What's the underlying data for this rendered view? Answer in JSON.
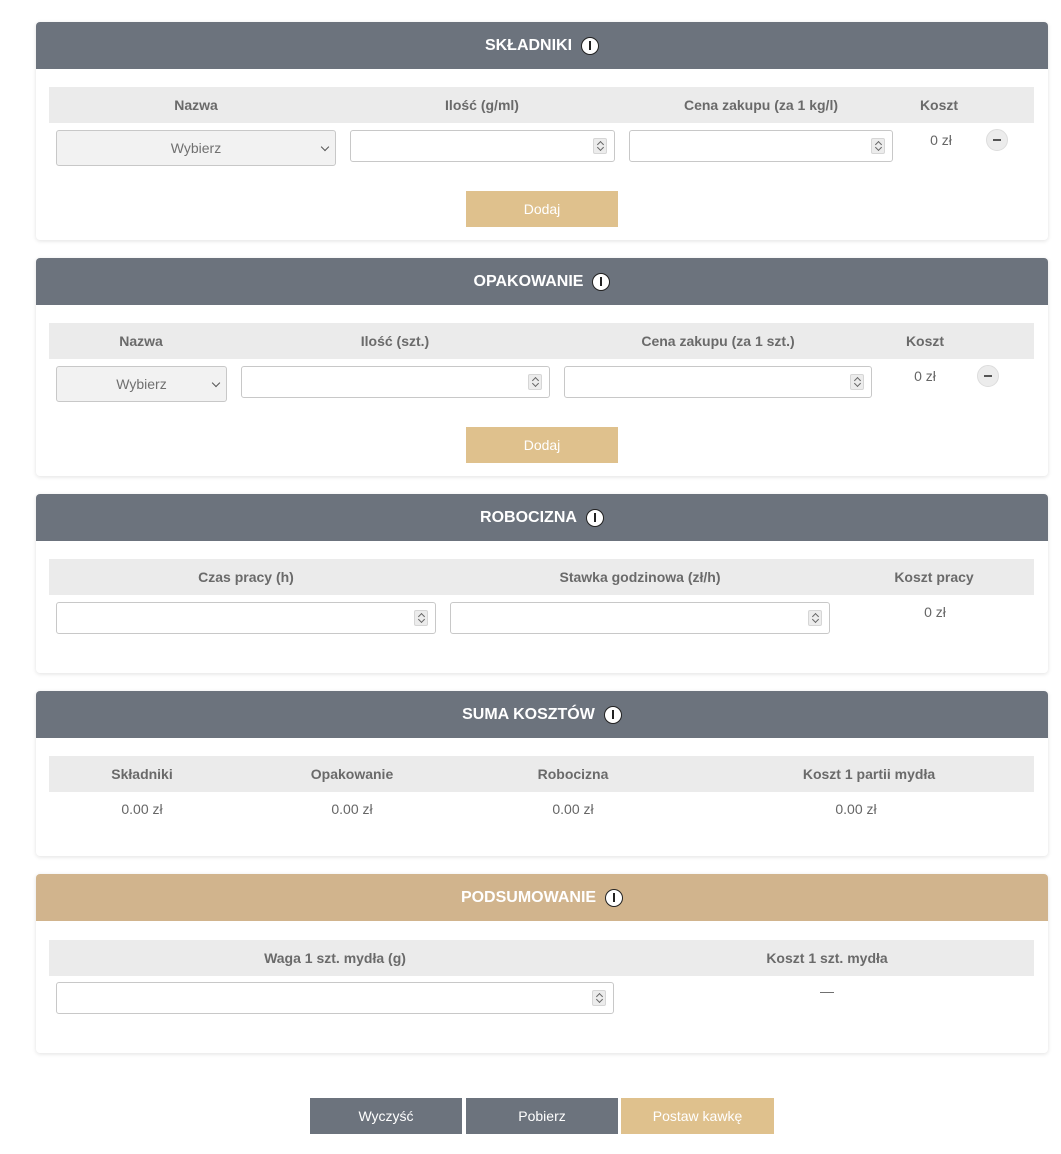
{
  "skladniki": {
    "title": "SKŁADNIKI",
    "col_name": "Nazwa",
    "col_qty": "Ilość (g/ml)",
    "col_price": "Cena zakupu (za 1 kg/l)",
    "col_cost": "Koszt",
    "select_value": "Wybierz",
    "cost_value": "0 zł",
    "add_label": "Dodaj"
  },
  "opakowanie": {
    "title": "OPAKOWANIE",
    "col_name": "Nazwa",
    "col_qty": "Ilość (szt.)",
    "col_price": "Cena zakupu (za 1 szt.)",
    "col_cost": "Koszt",
    "select_value": "Wybierz",
    "cost_value": "0 zł",
    "add_label": "Dodaj"
  },
  "robocizna": {
    "title": "ROBOCIZNA",
    "col_time": "Czas pracy (h)",
    "col_rate": "Stawka godzinowa (zł/h)",
    "col_cost": "Koszt pracy",
    "cost_value": "0 zł"
  },
  "suma": {
    "title": "SUMA KOSZTÓW",
    "columns": [
      "Składniki",
      "Opakowanie",
      "Robocizna",
      "Koszt 1 partii mydła"
    ],
    "values": [
      "0.00 zł",
      "0.00 zł",
      "0.00 zł",
      "0.00 zł"
    ]
  },
  "podsumowanie": {
    "title": "PODSUMOWANIE",
    "col_weight": "Waga 1 szt. mydła (g)",
    "col_cost": "Koszt 1 szt. mydła",
    "cost_value": "—"
  },
  "actions": {
    "clear_label": "Wyczyść",
    "download_label": "Pobierz",
    "coffee_label": "Postaw kawkę"
  },
  "colors": {
    "header_gray": "#6c737d",
    "header_gold": "#d1b48d",
    "button_gold": "#dfc18d",
    "table_head_bg": "#ebebeb"
  }
}
